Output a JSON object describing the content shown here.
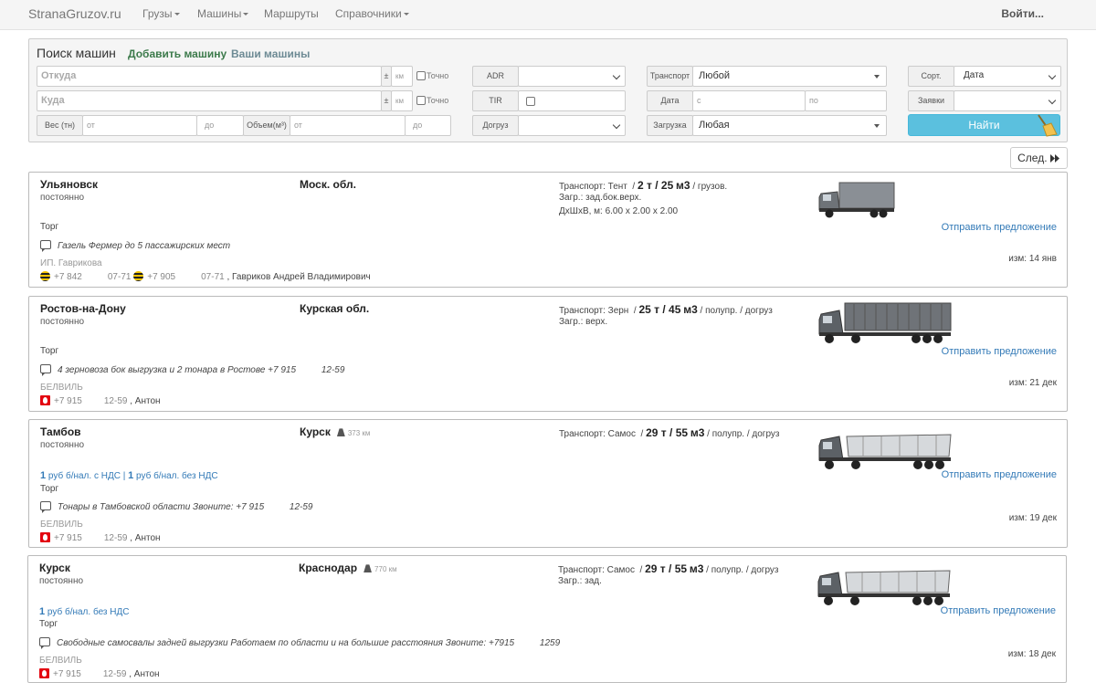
{
  "nav": {
    "brand": "StranaGruzov.ru",
    "items": [
      "Грузы",
      "Машины",
      "Маршруты",
      "Справочники"
    ],
    "login": "Войти..."
  },
  "search": {
    "title": "Поиск машин",
    "add_link": "Добавить машину",
    "my_link": "Ваши машины",
    "from_placeholder": "Откуда",
    "to_placeholder": "Куда",
    "pm": "±",
    "km": "км",
    "exact": "Точно",
    "weight_label": "Вес (тн)",
    "volume_label": "Объем(м³)",
    "from_ph": "от",
    "to_ph": "до",
    "adr_label": "ADR",
    "tir_label": "TIR",
    "dogruz_label": "Догруз",
    "transport_label": "Транспорт",
    "transport_value": "Любой",
    "date_label": "Дата",
    "date_from_ph": "с",
    "date_to_ph": "по",
    "loading_label": "Загрузка",
    "loading_value": "Любая",
    "sort_label": "Сорт.",
    "sort_value": "Дата",
    "requests_label": "Заявки",
    "find_button": "Найти",
    "next_button": "След."
  },
  "colors": {
    "link_green": "#3c7a4b",
    "link_gray": "#6d8a94",
    "accent": "#5bc0de",
    "link_blue": "#337ab7"
  },
  "cards": [
    {
      "from": "Ульяновск",
      "to": "Моск. обл.",
      "distance": "",
      "schedule": "постоянно",
      "transport": "Транспорт: Тент",
      "weight": "2 т",
      "volume": "25",
      "unit": "м3",
      "trailer": "/ грузов.",
      "line2": "Загр.: зад.бок.верх.",
      "line3": "ДхШхВ, м: 6.00 x 2.00 x 2.00",
      "price": "",
      "torg": "Торг",
      "note": "Газель Фермер до 5 пассажирских мест",
      "company": "ИП. Гаврикова",
      "phones": [
        {
          "operator": "beeline-icon",
          "number": "+7 842",
          "suffix": "07-71"
        },
        {
          "operator": "beeline-icon",
          "number": "+7 905",
          "suffix": "07-71"
        }
      ],
      "contact": ", Гавриков Андрей Владимирович",
      "offer": "Отправить предложение",
      "changed": "изм: 14 янв",
      "truck_icon": "van-truck-icon"
    },
    {
      "from": "Ростов-на-Дону",
      "to": "Курская обл.",
      "distance": "",
      "schedule": "постоянно",
      "transport": "Транспорт: Зерн",
      "weight": "25 т",
      "volume": "45",
      "unit": "м3",
      "trailer": "/ полупр. / догруз",
      "line2": "Загр.: верх.",
      "line3": "",
      "price": "",
      "torg": "Торг",
      "note": "4 зерновоза бок выгрузка и 2 тонара в Ростове +7 915          12-59",
      "company": "БЕЛВИЛЬ",
      "phones": [
        {
          "operator": "mts-icon",
          "number": "+7 915",
          "suffix": "12-59"
        }
      ],
      "contact": ", Антон",
      "offer": "Отправить предложение",
      "changed": "изм: 21 дек",
      "truck_icon": "grain-truck-icon"
    },
    {
      "from": "Тамбов",
      "to": "Курск",
      "distance": "373 км",
      "schedule": "постоянно",
      "transport": "Транспорт: Самос",
      "weight": "29 т",
      "volume": "55",
      "unit": "м3",
      "trailer": "/ полупр. / догруз",
      "line2": "",
      "line3": "",
      "price_parts": [
        "1",
        " руб б/нал. с НДС | ",
        "1",
        " руб б/нал. без НДС"
      ],
      "torg": "Торг",
      "note": "Тонары в Тамбовской области Звоните: +7 915          12-59",
      "company": "БЕЛВИЛЬ",
      "phones": [
        {
          "operator": "mts-icon",
          "number": "+7 915",
          "suffix": "12-59"
        }
      ],
      "contact": ", Антон",
      "offer": "Отправить предложение",
      "changed": "изм: 19 дек",
      "truck_icon": "dump-truck-icon"
    },
    {
      "from": "Курск",
      "to": "Краснодар",
      "distance": "770 км",
      "schedule": "постоянно",
      "transport": "Транспорт: Самос",
      "weight": "29 т",
      "volume": "55",
      "unit": "м3",
      "trailer": "/ полупр. / догруз",
      "line2": "Загр.: зад.",
      "line3": "",
      "price_parts": [
        "1",
        " руб б/нал. без НДС"
      ],
      "torg": "Торг",
      "note": "Свободные самосвалы задней выгрузки Работаем по области и на большие расстояния Звоните: +7915          1259",
      "company": "БЕЛВИЛЬ",
      "phones": [
        {
          "operator": "mts-icon",
          "number": "+7 915",
          "suffix": "12-59"
        }
      ],
      "contact": ", Антон",
      "offer": "Отправить предложение",
      "changed": "изм: 18 дек",
      "truck_icon": "dump-truck-icon"
    }
  ]
}
